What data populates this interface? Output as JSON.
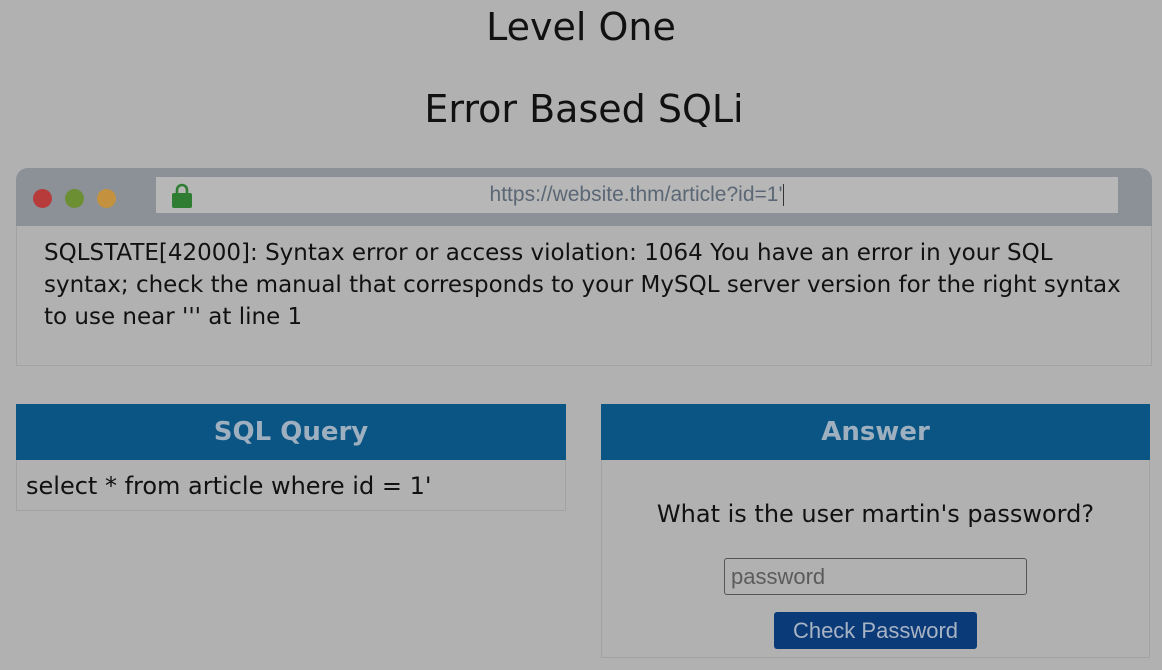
{
  "page": {
    "title": "Level One",
    "subtitle": "Error Based SQLi"
  },
  "browser": {
    "url": "https://website.thm/article?id=1'",
    "content": "SQLSTATE[42000]: Syntax error or access violation: 1064 You have an error in your SQL syntax; check the manual that corresponds to your MySQL server version for the right syntax to use near ''' at line 1",
    "dots": [
      "red-dot",
      "green-dot",
      "yellow-dot"
    ],
    "icon": "lock-icon",
    "colors": {
      "bar": "#8b9197",
      "lock": "#2e7d32"
    }
  },
  "sql_panel": {
    "header": "SQL Query",
    "query": "select * from article where id = 1'"
  },
  "answer_panel": {
    "header": "Answer",
    "question": "What is the user martin's password?",
    "input_placeholder": "password",
    "input_value": "",
    "button_label": "Check Password"
  },
  "colors": {
    "background": "#b1b1b1",
    "header": "#0a5584",
    "button": "#0b3a78"
  }
}
